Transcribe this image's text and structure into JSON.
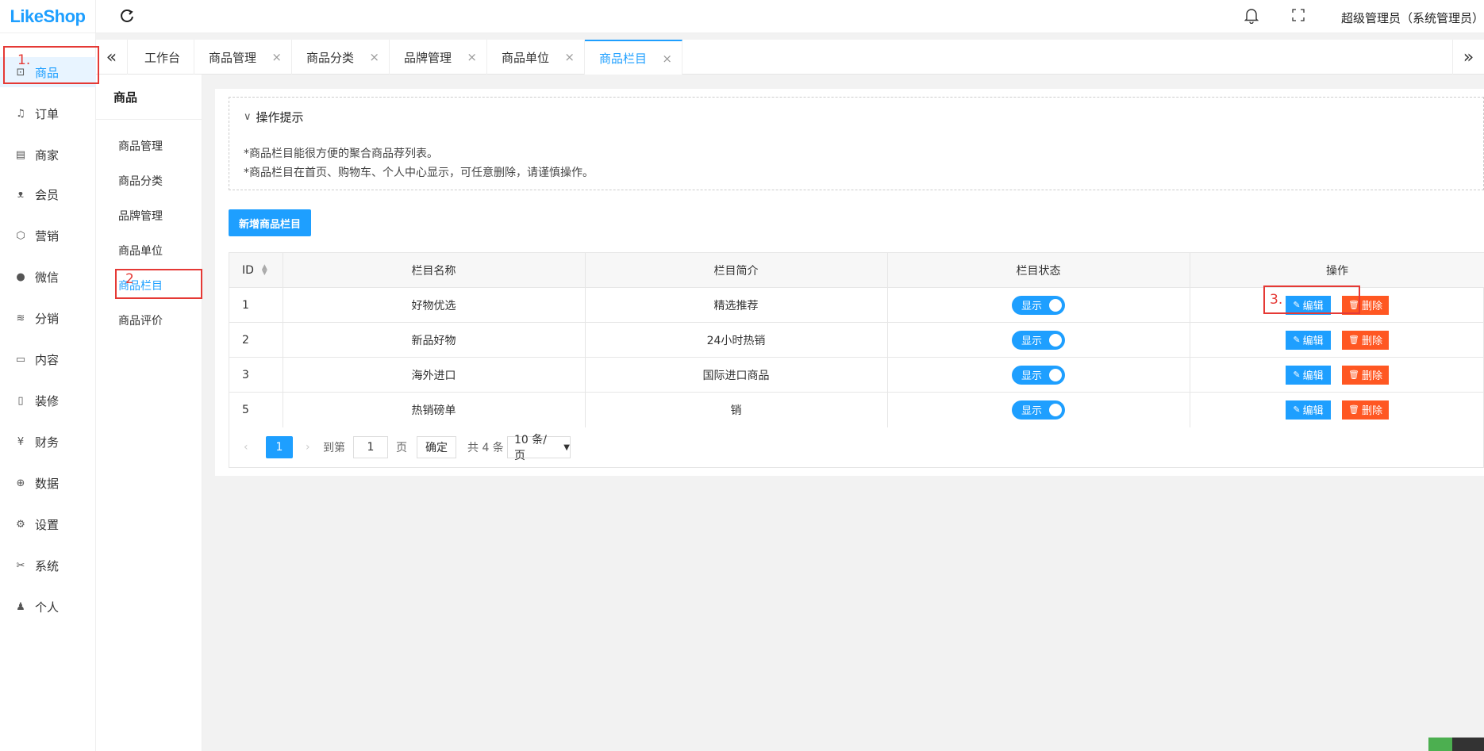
{
  "app": {
    "logo": "LikeShop",
    "user": "超级管理员（系统管理员）"
  },
  "sidebar": {
    "items": [
      {
        "label": "商品",
        "icon": "goods-icon",
        "glyph": "⊡"
      },
      {
        "label": "订单",
        "icon": "bell-icon",
        "glyph": "♫"
      },
      {
        "label": "商家",
        "icon": "store-icon",
        "glyph": "▤"
      },
      {
        "label": "会员",
        "icon": "user-icon",
        "glyph": "ᴥ"
      },
      {
        "label": "营销",
        "icon": "box-icon",
        "glyph": "⬡"
      },
      {
        "label": "微信",
        "icon": "wechat-icon",
        "glyph": "●"
      },
      {
        "label": "分销",
        "icon": "layers-icon",
        "glyph": "≋"
      },
      {
        "label": "内容",
        "icon": "book-icon",
        "glyph": "▭"
      },
      {
        "label": "装修",
        "icon": "mobile-icon",
        "glyph": "▯"
      },
      {
        "label": "财务",
        "icon": "yen-icon",
        "glyph": "¥"
      },
      {
        "label": "数据",
        "icon": "globe-icon",
        "glyph": "⊕"
      },
      {
        "label": "设置",
        "icon": "gear-icon",
        "glyph": "⚙"
      },
      {
        "label": "系统",
        "icon": "tools-icon",
        "glyph": "✂"
      },
      {
        "label": "个人",
        "icon": "person-icon",
        "glyph": "♟"
      }
    ]
  },
  "tabs": [
    {
      "label": "工作台",
      "closable": false
    },
    {
      "label": "商品管理",
      "closable": true
    },
    {
      "label": "商品分类",
      "closable": true
    },
    {
      "label": "品牌管理",
      "closable": true
    },
    {
      "label": "商品单位",
      "closable": true
    },
    {
      "label": "商品栏目",
      "closable": true
    }
  ],
  "submenu": {
    "title": "商品",
    "items": [
      "商品管理",
      "商品分类",
      "品牌管理",
      "商品单位",
      "商品栏目",
      "商品评价"
    ]
  },
  "tips": {
    "title": "操作提示",
    "lines": [
      "*商品栏目能很方便的聚合商品荐列表。",
      "*商品栏目在首页、购物车、个人中心显示，可任意删除，请谨慎操作。"
    ]
  },
  "add_button": "新增商品栏目",
  "table": {
    "headers": [
      "ID",
      "栏目名称",
      "栏目简介",
      "栏目状态",
      "操作"
    ],
    "rows": [
      {
        "id": "1",
        "name": "好物优选",
        "desc": "精选推荐",
        "status": "显示"
      },
      {
        "id": "2",
        "name": "新品好物",
        "desc": "24小时热销",
        "status": "显示"
      },
      {
        "id": "3",
        "name": "海外进口",
        "desc": "国际进口商品",
        "status": "显示"
      },
      {
        "id": "5",
        "name": "热销磅单",
        "desc": "销",
        "status": "显示"
      }
    ],
    "edit_label": "编辑",
    "delete_label": "删除"
  },
  "pager": {
    "current": "1",
    "goto_label": "到第",
    "page_input": "1",
    "page_unit": "页",
    "confirm": "确定",
    "total": "共 4 条",
    "per_page": "10 条/页"
  },
  "annotations": [
    "1.",
    "2",
    "3."
  ],
  "colors": {
    "primary": "#1e9fff",
    "danger": "#ff5722",
    "annotation": "#e53935"
  }
}
